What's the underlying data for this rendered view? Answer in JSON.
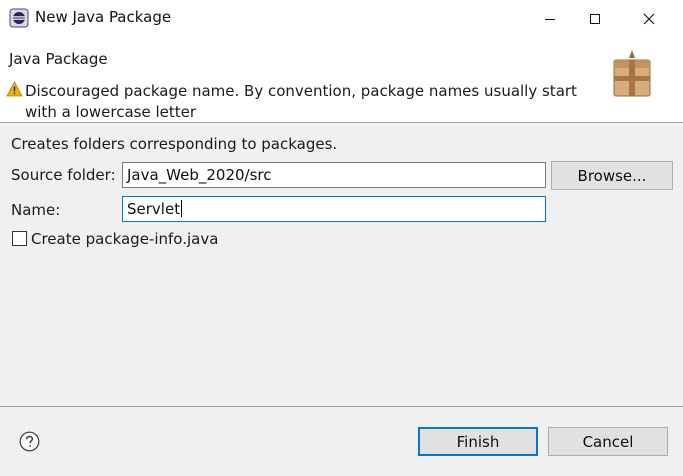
{
  "window": {
    "title": "New Java Package",
    "app_icon": "eclipse-icon",
    "controls": [
      "minimize-icon",
      "maximize-icon",
      "close-icon"
    ]
  },
  "header": {
    "title": "Java Package",
    "message_icon": "warning-icon",
    "message": "Discouraged package name. By convention, package names usually start with a lowercase letter",
    "banner_icon": "package-icon"
  },
  "form": {
    "description": "Creates folders corresponding to packages.",
    "source_folder_label": "Source folder:",
    "source_folder_value": "Java_Web_2020/src",
    "browse_label": "Browse...",
    "name_label": "Name:",
    "name_value": "Servlet",
    "create_info_label": "Create package-info.java",
    "create_info_checked": false
  },
  "footer": {
    "help_icon": "help-icon",
    "finish_label": "Finish",
    "cancel_label": "Cancel"
  },
  "colors": {
    "focus_border": "#0078d7",
    "warning": "#f0b400",
    "dialog_bg": "#f0f0f0"
  }
}
